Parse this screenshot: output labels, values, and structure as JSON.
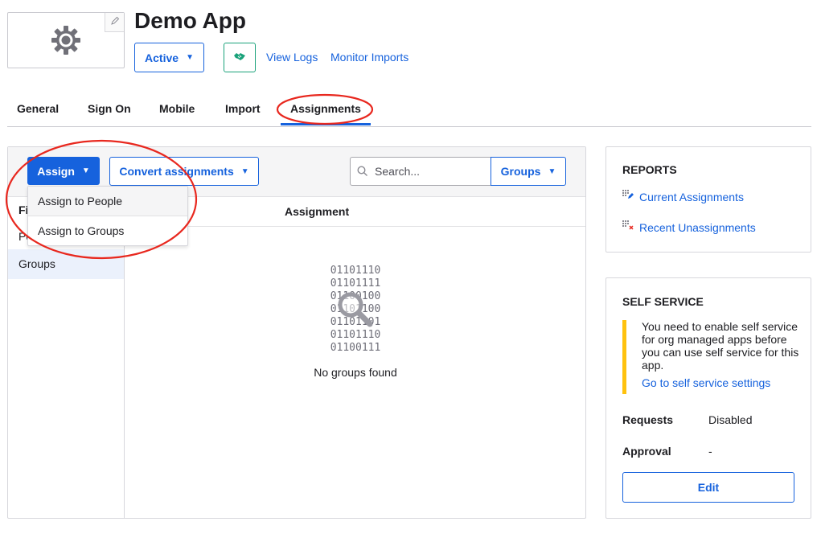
{
  "app": {
    "title": "Demo App",
    "status_label": "Active",
    "links": {
      "view_logs": "View Logs",
      "monitor_imports": "Monitor Imports"
    },
    "logo_icon": "gear-icon"
  },
  "tabs": [
    {
      "label": "General"
    },
    {
      "label": "Sign On"
    },
    {
      "label": "Mobile"
    },
    {
      "label": "Import"
    },
    {
      "label": "Assignments",
      "active": true
    }
  ],
  "toolbar": {
    "assign_label": "Assign",
    "convert_label": "Convert assignments",
    "search_placeholder": "Search...",
    "groups_label": "Groups"
  },
  "assign_menu": {
    "items": [
      {
        "label": "Assign to People"
      },
      {
        "label": "Assign to Groups"
      }
    ]
  },
  "filters": {
    "heading": "Fi",
    "people": "Pe",
    "groups": "Groups"
  },
  "table": {
    "assignment_header": "Assignment",
    "binary_lines": [
      "01101110",
      "01101111",
      "01100100",
      "01101100",
      "01101101",
      "01101110",
      "01100111"
    ],
    "empty_message": "No groups found"
  },
  "reports": {
    "heading": "REPORTS",
    "items": [
      {
        "label": "Current Assignments",
        "icon": "report-grid-edit-icon"
      },
      {
        "label": "Recent Unassignments",
        "icon": "report-grid-remove-icon"
      }
    ]
  },
  "self_service": {
    "heading": "SELF SERVICE",
    "notice": "You need to enable self service for org managed apps before you can use self service for this app.",
    "notice_link": "Go to self service settings",
    "requests_label": "Requests",
    "requests_value": "Disabled",
    "approval_label": "Approval",
    "approval_value": "-",
    "edit_label": "Edit"
  },
  "colors": {
    "primary": "#1662dd",
    "success": "#1aa27a",
    "warning": "#ffc20e",
    "annotation": "#e8281f"
  }
}
